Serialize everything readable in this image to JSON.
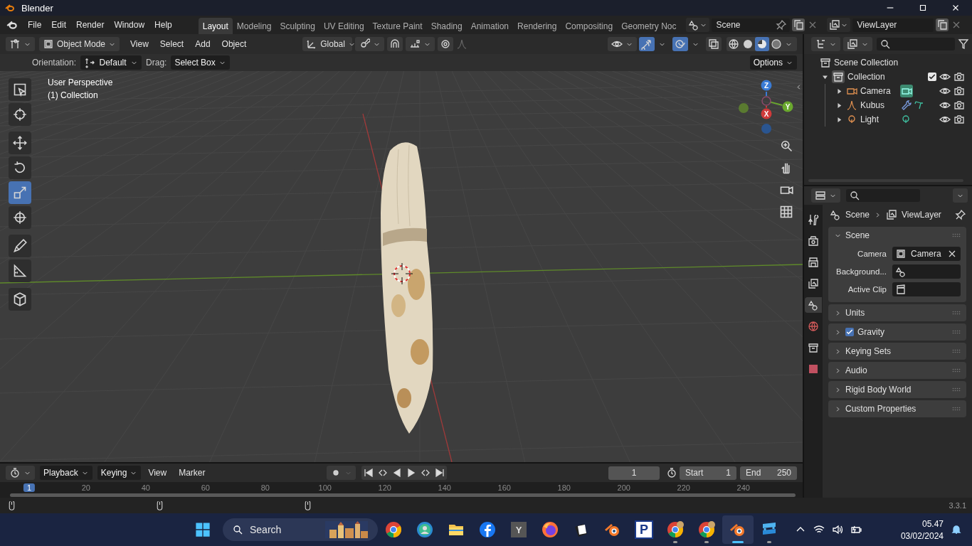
{
  "window": {
    "title": "Blender"
  },
  "menus": [
    "File",
    "Edit",
    "Render",
    "Window",
    "Help"
  ],
  "workspaces": [
    {
      "label": "Layout",
      "selected": true
    },
    {
      "label": "Modeling",
      "selected": false
    },
    {
      "label": "Sculpting",
      "selected": false
    },
    {
      "label": "UV Editing",
      "selected": false
    },
    {
      "label": "Texture Paint",
      "selected": false
    },
    {
      "label": "Shading",
      "selected": false
    },
    {
      "label": "Animation",
      "selected": false
    },
    {
      "label": "Rendering",
      "selected": false
    },
    {
      "label": "Compositing",
      "selected": false
    },
    {
      "label": "Geometry Noc",
      "selected": false
    }
  ],
  "scene": "Scene",
  "view_layer": "ViewLayer",
  "viewport_header": {
    "mode": "Object Mode",
    "menus": [
      "View",
      "Select",
      "Add",
      "Object"
    ],
    "transform_orientation": "Global",
    "snap_on": false,
    "proportional_on": false,
    "gizmos_on": true,
    "overlays_on": true,
    "xray_on": false,
    "shading": [
      {
        "kind": "wireframe",
        "selected": false
      },
      {
        "kind": "solid",
        "selected": false
      },
      {
        "kind": "material",
        "selected": true
      },
      {
        "kind": "rendered",
        "selected": false
      }
    ]
  },
  "tool_settings": {
    "orientation_label": "Orientation:",
    "orientation": "Default",
    "drag_label": "Drag:",
    "drag": "Select Box",
    "options": "Options"
  },
  "tool_groups": [
    {
      "tools": [
        {
          "kind": "select",
          "selected": false
        },
        {
          "kind": "cursor",
          "selected": false
        }
      ]
    },
    {
      "tools": [
        {
          "kind": "move",
          "selected": false
        },
        {
          "kind": "rotate",
          "selected": false
        },
        {
          "kind": "scale",
          "selected": true
        },
        {
          "kind": "transform",
          "selected": false
        }
      ]
    },
    {
      "tools": [
        {
          "kind": "annotate",
          "selected": false
        },
        {
          "kind": "measure",
          "selected": false
        }
      ]
    },
    {
      "tools": [
        {
          "kind": "add_cube",
          "selected": false
        }
      ]
    }
  ],
  "viewport": {
    "view_name": "User Perspective",
    "collection": "(1) Collection",
    "axes": [
      {
        "label": "Z",
        "kind": "z"
      },
      {
        "label": "Y",
        "kind": "y"
      },
      {
        "label": "X",
        "kind": "x"
      }
    ]
  },
  "timeline": {
    "menus": [
      {
        "label": "Playback",
        "dropdown": true
      },
      {
        "label": "Keying",
        "dropdown": true
      },
      {
        "label": "View",
        "dropdown": false
      },
      {
        "label": "Marker",
        "dropdown": false
      }
    ],
    "current_frame": "1",
    "start_label": "Start",
    "start": "1",
    "end_label": "End",
    "end": "250",
    "ruler": [
      "1",
      "20",
      "40",
      "60",
      "80",
      "100",
      "120",
      "140",
      "160",
      "180",
      "200",
      "220",
      "240"
    ]
  },
  "status_bar": {
    "version": "3.3.1"
  },
  "outliner": {
    "root": "Scene Collection",
    "items": [
      {
        "label": "Collection",
        "kind": "collection",
        "expanded": true,
        "checked": true,
        "children": [
          {
            "label": "Camera",
            "kind": "camera",
            "expanded": false
          },
          {
            "label": "Kubus",
            "kind": "mesh",
            "expanded": false
          },
          {
            "label": "Light",
            "kind": "light",
            "expanded": false
          }
        ]
      }
    ]
  },
  "properties": {
    "tabs": [
      {
        "kind": "tool",
        "selected": false
      },
      {
        "kind": "render",
        "selected": false
      },
      {
        "kind": "output",
        "selected": false
      },
      {
        "kind": "view_layer",
        "selected": false
      },
      {
        "kind": "scene",
        "selected": true
      },
      {
        "kind": "world",
        "selected": false
      },
      {
        "kind": "collection",
        "selected": false
      },
      {
        "kind": "texture",
        "selected": false
      }
    ],
    "breadcrumb": [
      "Scene",
      "ViewLayer"
    ],
    "panels": [
      {
        "title": "Scene",
        "expanded": true,
        "fields": [
          {
            "label": "Camera",
            "kind": "object",
            "value": "Camera"
          },
          {
            "label": "Background...",
            "kind": "scene"
          },
          {
            "label": "Active Clip",
            "kind": "clip"
          }
        ]
      },
      {
        "title": "Units",
        "expanded": false
      },
      {
        "title": "Gravity",
        "expanded": false,
        "checked": true
      },
      {
        "title": "Keying Sets",
        "expanded": false
      },
      {
        "title": "Audio",
        "expanded": false
      },
      {
        "title": "Rigid Body World",
        "expanded": false
      },
      {
        "title": "Custom Properties",
        "expanded": false
      }
    ]
  },
  "taskbar": {
    "search": {
      "placeholder": "Search"
    },
    "apps": [
      {
        "kind": "chrome",
        "running": false,
        "selected": false
      },
      {
        "kind": "edge",
        "running": false,
        "selected": false
      },
      {
        "kind": "files",
        "running": false,
        "selected": false
      },
      {
        "kind": "facebook",
        "running": false,
        "selected": false
      },
      {
        "kind": "letter",
        "label": "Y",
        "running": false,
        "selected": false
      },
      {
        "kind": "firefox",
        "running": false,
        "selected": false
      },
      {
        "kind": "papers",
        "running": false,
        "selected": false
      },
      {
        "kind": "blender",
        "running": false,
        "selected": false
      },
      {
        "kind": "letter_blue",
        "label": "P",
        "running": false,
        "selected": false
      },
      {
        "kind": "chrome_badge",
        "running": true,
        "selected": false
      },
      {
        "kind": "chrome_badge",
        "running": true,
        "selected": false
      },
      {
        "kind": "blender",
        "running": true,
        "selected": true
      },
      {
        "kind": "squares",
        "running": true,
        "selected": false
      }
    ],
    "time": "05.47",
    "date": "03/02/2024"
  }
}
